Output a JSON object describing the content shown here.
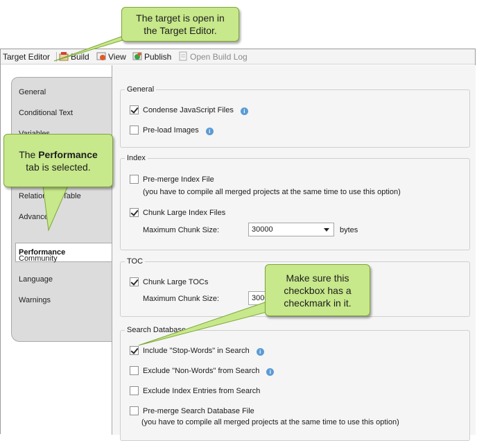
{
  "toolbar": {
    "title": "Target Editor",
    "build": "Build",
    "view": "View",
    "publish": "Publish",
    "open_build_log": "Open Build Log"
  },
  "tabs": {
    "general": "General",
    "conditional_text": "Conditional Text",
    "variables": "Variables",
    "relationship_table": "Relationship Table",
    "advanced": "Advanced",
    "performance": "Performance",
    "community": "Community",
    "language": "Language",
    "warnings": "Warnings"
  },
  "general_group": {
    "title": "General",
    "condense_js": "Condense JavaScript Files",
    "condense_js_checked": true,
    "preload_images": "Pre-load Images",
    "preload_images_checked": false
  },
  "index_group": {
    "title": "Index",
    "premerge": "Pre-merge Index File",
    "premerge_checked": false,
    "premerge_note": "(you have to compile all merged projects at the same time to use this option)",
    "chunk": "Chunk Large Index Files",
    "chunk_checked": true,
    "max_chunk_label": "Maximum Chunk Size:",
    "max_chunk_value": "30000",
    "unit": "bytes"
  },
  "toc_group": {
    "title": "TOC",
    "chunk": "Chunk Large TOCs",
    "chunk_checked": true,
    "max_chunk_label": "Maximum Chunk Size:",
    "max_chunk_value": "30000"
  },
  "search_group": {
    "title": "Search Database",
    "stop_words": "Include \"Stop-Words\" in Search",
    "stop_words_checked": true,
    "non_words": "Exclude \"Non-Words\" from Search",
    "non_words_checked": false,
    "index_entries": "Exclude Index Entries from Search",
    "index_entries_checked": false,
    "premerge": "Pre-merge Search Database File",
    "premerge_checked": false,
    "premerge_note": "(you have to compile all merged projects at the same time to use this option)"
  },
  "callouts": {
    "target_open": {
      "line1": "The target is open in",
      "line2": "the Target Editor."
    },
    "performance_tab": {
      "line1_pre": "The ",
      "line1_bold": "Performance",
      "line2": "tab is selected."
    },
    "checkbox_note": {
      "line1": "Make sure this",
      "line2": "checkbox has a",
      "line3": "checkmark in it."
    }
  },
  "colors": {
    "callout_fill": "#c7e88b",
    "callout_border": "#7da638",
    "info_icon": "#5b9bd5",
    "tab_panel": "#dcdcdc"
  }
}
